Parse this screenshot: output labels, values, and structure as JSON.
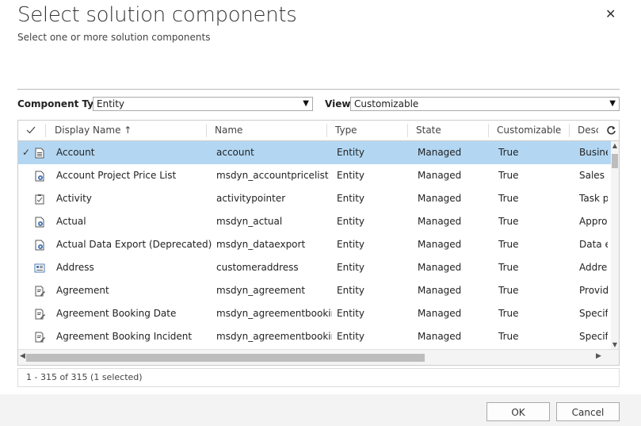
{
  "dialog": {
    "title": "Select solution components",
    "subtitle": "Select one or more solution components",
    "close_glyph": "✕"
  },
  "filters": {
    "component_type_label": "Component Type",
    "component_type_value": "Entity",
    "view_label": "View",
    "view_value": "Customizable"
  },
  "grid": {
    "columns": [
      "Display Name",
      "Name",
      "Type",
      "State",
      "Customizable",
      "Desc"
    ],
    "sort_indicator": "↑",
    "rows": [
      {
        "icon": "entity-icon",
        "selected": true,
        "display": "Account",
        "name": "account",
        "type": "Entity",
        "state": "Managed",
        "customizable": "True",
        "desc": "Business"
      },
      {
        "icon": "gear-doc-icon",
        "selected": false,
        "display": "Account Project Price List",
        "name": "msdyn_accountpricelist",
        "type": "Entity",
        "state": "Managed",
        "customizable": "True",
        "desc": "Sales p"
      },
      {
        "icon": "clipboard-icon",
        "selected": false,
        "display": "Activity",
        "name": "activitypointer",
        "type": "Entity",
        "state": "Managed",
        "customizable": "True",
        "desc": "Task pe"
      },
      {
        "icon": "gear-doc-icon",
        "selected": false,
        "display": "Actual",
        "name": "msdyn_actual",
        "type": "Entity",
        "state": "Managed",
        "customizable": "True",
        "desc": "Approv"
      },
      {
        "icon": "gear-doc-icon",
        "selected": false,
        "display": "Actual Data Export (Deprecated)",
        "name": "msdyn_dataexport",
        "type": "Entity",
        "state": "Managed",
        "customizable": "True",
        "desc": "Data ex"
      },
      {
        "icon": "address-card-icon",
        "selected": false,
        "display": "Address",
        "name": "customeraddress",
        "type": "Entity",
        "state": "Managed",
        "customizable": "True",
        "desc": "Address"
      },
      {
        "icon": "doc-edit-icon",
        "selected": false,
        "display": "Agreement",
        "name": "msdyn_agreement",
        "type": "Entity",
        "state": "Managed",
        "customizable": "True",
        "desc": "Provide"
      },
      {
        "icon": "doc-edit-icon",
        "selected": false,
        "display": "Agreement Booking Date",
        "name": "msdyn_agreementbooking...",
        "type": "Entity",
        "state": "Managed",
        "customizable": "True",
        "desc": "Specify"
      },
      {
        "icon": "doc-edit-icon",
        "selected": false,
        "display": "Agreement Booking Incident",
        "name": "msdyn_agreementbookingi...",
        "type": "Entity",
        "state": "Managed",
        "customizable": "True",
        "desc": "Specify"
      },
      {
        "icon": "doc-edit-icon",
        "selected": false,
        "display": "",
        "name": "",
        "type": "",
        "state": "",
        "customizable": "",
        "desc": ""
      }
    ]
  },
  "status": {
    "text": "1 - 315 of 315 (1 selected)"
  },
  "buttons": {
    "ok": "OK",
    "cancel": "Cancel"
  },
  "colors": {
    "selected_row": "#b3d7f3",
    "footer": "#f3f3f3"
  }
}
